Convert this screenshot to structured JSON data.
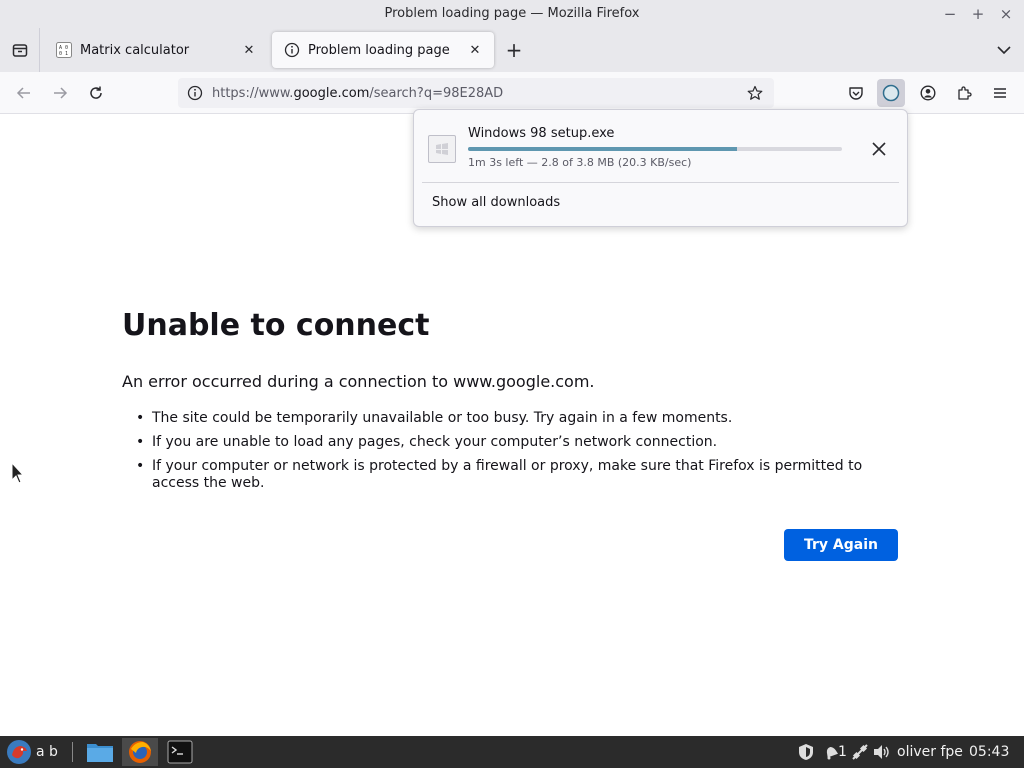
{
  "window": {
    "title": "Problem loading page — Mozilla Firefox",
    "minimize": "−",
    "maximize": "+",
    "close": "×"
  },
  "tabs": [
    {
      "label": "Matrix calculator",
      "icon": "matrix-icon",
      "active": false
    },
    {
      "label": "Problem loading page",
      "icon": "info-icon",
      "active": true
    }
  ],
  "navbar": {
    "url_prefix": "https://www.",
    "url_host": "google.com",
    "url_rest": "/search?q=98E28AD"
  },
  "downloads_panel": {
    "file_name": "Windows 98 setup.exe",
    "status": "1m 3s left — 2.8 of 3.8 MB (20.3 KB/sec)",
    "progress": 0.72,
    "show_all_label": "Show all downloads"
  },
  "error_page": {
    "title": "Unable to connect",
    "description": "An error occurred during a connection to www.google.com.",
    "items": [
      "The site could be temporarily unavailable or too busy. Try again in a few moments.",
      "If you are unable to load any pages, check your computer’s network connection.",
      "If your computer or network is protected by a firewall or proxy, make sure that Firefox is permitted to access the web."
    ],
    "try_again_label": "Try Again"
  },
  "taskbar": {
    "workspace_label": "a b",
    "notification_count": "1",
    "user_label": "oliver fpe",
    "clock": "05:43"
  },
  "colors": {
    "accent": "#0061e0",
    "progress": "#5f97b0"
  }
}
